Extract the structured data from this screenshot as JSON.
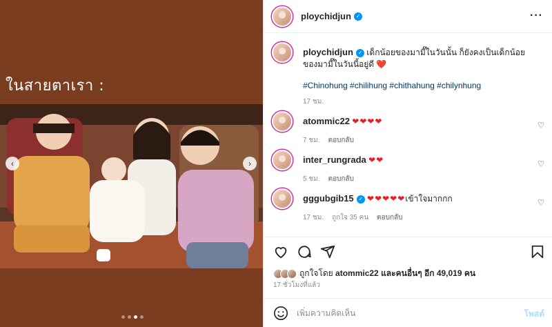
{
  "media": {
    "caption": "ในสายตาเรา  :",
    "carousel_position": {
      "current": 3,
      "total": 4
    }
  },
  "post": {
    "username": "ploychidjun",
    "more_label": "···"
  },
  "caption_comment": {
    "username": "ploychidjun",
    "text": "เด็กน้อยของมามี๊ในวันนั้น ก็ยังคงเป็นเด็กน้อยของมามี๊ในวันนี้อยู่ดี ",
    "heart": "❤️",
    "hashtags": "#Chinohung #chilihung #chithahung #chilynhung",
    "time": "17 ชม."
  },
  "comments": [
    {
      "username": "atommic22",
      "text": "❤❤❤❤",
      "time": "7 ชม.",
      "likes": "",
      "reply": "ตอบกลับ"
    },
    {
      "username": "inter_rungrada",
      "text": "❤❤",
      "time": "5 ชม.",
      "likes": "",
      "reply": "ตอบกลับ"
    },
    {
      "username": "gggubgib15",
      "text": "❤❤❤❤❤",
      "suffix": "เข้าใจมากกก",
      "time": "17 ชม.",
      "likes": "ถูกใจ 35 คน",
      "reply": "ตอบกลับ"
    }
  ],
  "likes": {
    "prefix": "ถูกใจโดย ",
    "user": "atommic22",
    "middle": " และคนอื่นๆ อีก ",
    "count": "49,019 คน"
  },
  "time_ago": "17 ชั่วโมงที่แล้ว",
  "composer": {
    "placeholder": "เพิ่มความคิดเห็น",
    "post_label": "โพสต์"
  },
  "colors": {
    "link": "#00376b",
    "verified": "#0095f6",
    "heart": "#ed1c24",
    "post_disabled": "#b3dbff"
  }
}
